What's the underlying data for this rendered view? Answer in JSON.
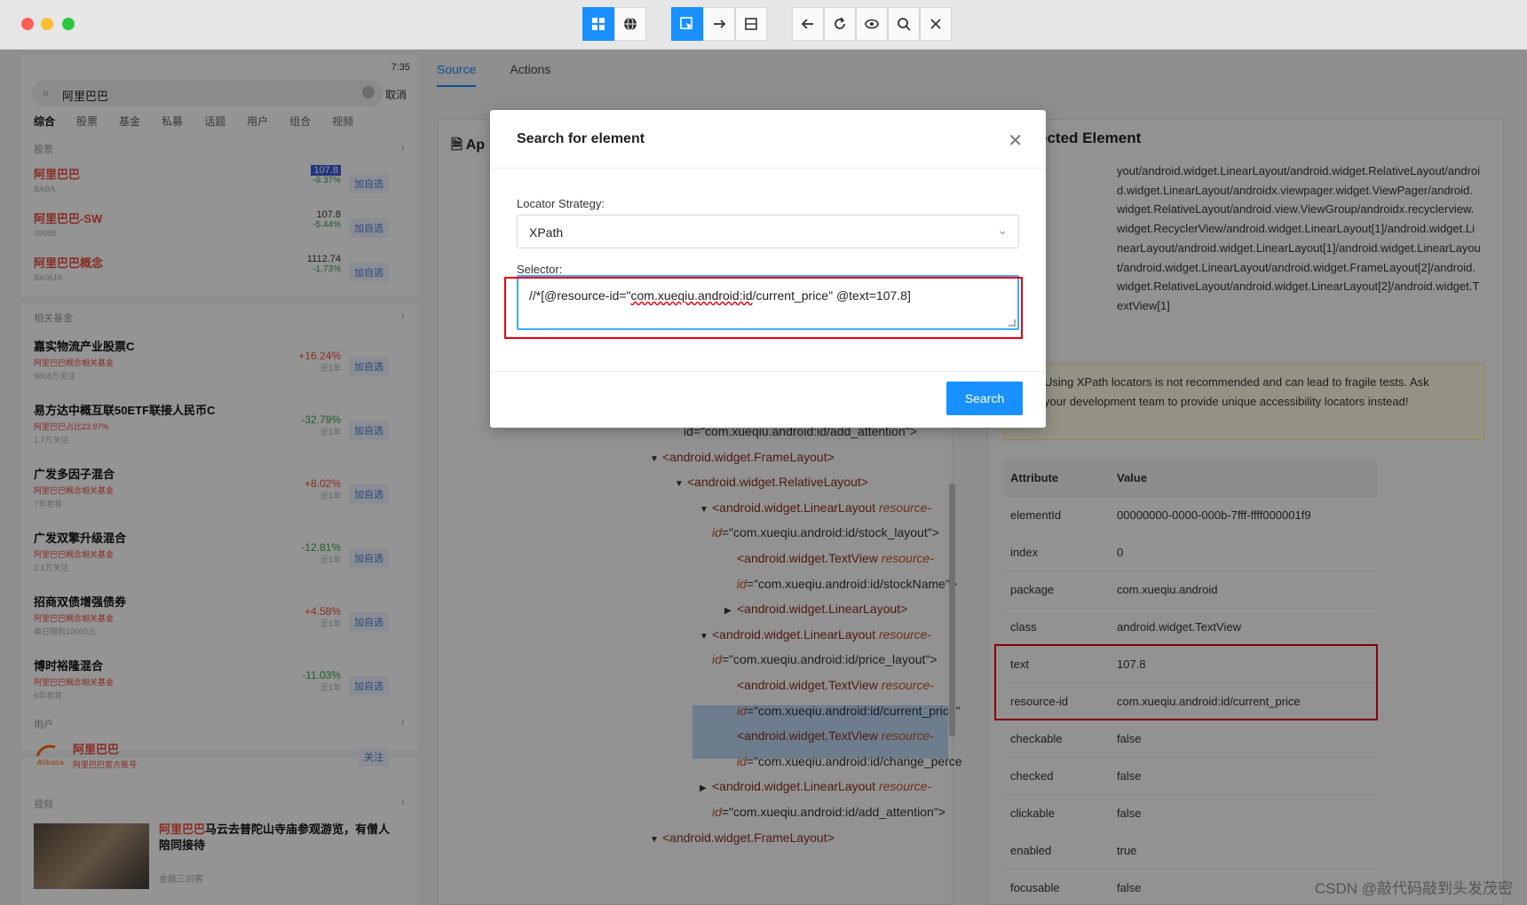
{
  "toolbar": {
    "buttons": [
      "grid-icon",
      "globe-icon",
      "select-element-icon",
      "swipe-icon",
      "tap-coordinates-icon",
      "back-icon",
      "refresh-icon",
      "show-icon",
      "search-icon",
      "close-icon"
    ]
  },
  "phone": {
    "status": "7:35",
    "search_query": "阿里巴巴",
    "cancel": "取消",
    "categories": [
      "综合",
      "股票",
      "基金",
      "私募",
      "话题",
      "用户",
      "组合",
      "视频"
    ],
    "sections": {
      "stocks": "股票",
      "funds": "相关基金",
      "users": "用户",
      "videos": "视频"
    },
    "add_label": "加自选",
    "follow_label": "关注",
    "stocks": [
      {
        "name": "阿里巴巴",
        "code": "BABA",
        "price": "107.8",
        "change": "-9.37%"
      },
      {
        "name": "阿里巴巴-SW",
        "code": "09988",
        "price": "107.8",
        "change": "-5.44%"
      },
      {
        "name": "阿里巴巴概念",
        "code": "BK0519",
        "price": "1112.74",
        "change": "-1.73%"
      }
    ],
    "funds": [
      {
        "name": "嘉实物流产业股票C",
        "tag": "阿里巴巴概念相关基金",
        "sub": "9868万关注",
        "pct": "+16.24%",
        "period": "近1年"
      },
      {
        "name": "易方达中概互联50ETF联接人民币C",
        "tag": "阿里巴巴占比23.97%",
        "sub": "1.7万关注",
        "pct": "-32.79%",
        "period": "近1年"
      },
      {
        "name": "广发多因子混合",
        "tag": "阿里巴巴概念相关基金",
        "sub": "7年老将",
        "pct": "+8.02%",
        "period": "近1年"
      },
      {
        "name": "广发双擎升级混合",
        "tag": "阿里巴巴概念相关基金",
        "sub": "2.1万关注",
        "pct": "-12.81%",
        "period": "近1年"
      },
      {
        "name": "招商双债增强债券",
        "tag": "阿里巴巴概念相关基金",
        "sub": "单日限购10000元",
        "pct": "+4.58%",
        "period": "近1年"
      },
      {
        "name": "博时裕隆混合",
        "tag": "阿里巴巴概念相关基金",
        "sub": "6年老将",
        "pct": "-11.03%",
        "period": "近1年"
      }
    ],
    "user": {
      "name": "阿里巴巴",
      "desc": "阿里巴巴官方账号"
    },
    "video": {
      "highlight": "阿里巴巴",
      "title": "马云去普陀山寺庙参观游览，有僧人陪同接待",
      "source": "金融三剑客"
    }
  },
  "tabs": [
    {
      "label": "Source",
      "active": true
    },
    {
      "label": "Actions",
      "active": false
    }
  ],
  "source_panel": {
    "title": "Ap",
    "tree": [
      {
        "indent": 0,
        "toggle": "",
        "tag": "",
        "attr": "",
        "val": "id=\"com.xueqiu.android:id/add_attention\">"
      },
      {
        "indent": 1,
        "toggle": "▼",
        "tag": "<android.widget.FrameLayout>",
        "attr": "",
        "val": ""
      },
      {
        "indent": 2,
        "toggle": "▼",
        "tag": "<android.widget.RelativeLayout>",
        "attr": "",
        "val": ""
      },
      {
        "indent": 3,
        "toggle": "▼",
        "tag": "<android.widget.LinearLayout",
        "attr": " resource-",
        "val": ""
      },
      {
        "indent": 3,
        "toggle": "",
        "tag": "",
        "attr": "id",
        "val": "=\"com.xueqiu.android:id/stock_layout\">"
      },
      {
        "indent": 4,
        "toggle": "",
        "tag": "<android.widget.TextView",
        "attr": " resource-",
        "val": ""
      },
      {
        "indent": 4,
        "toggle": "",
        "tag": "",
        "attr": "id",
        "val": "=\"com.xueqiu.android:id/stockName\">"
      },
      {
        "indent": 4,
        "toggle": "▶",
        "tag": "<android.widget.LinearLayout>",
        "attr": "",
        "val": ""
      },
      {
        "indent": 3,
        "toggle": "▼",
        "tag": "<android.widget.LinearLayout",
        "attr": " resource-",
        "val": ""
      },
      {
        "indent": 3,
        "toggle": "",
        "tag": "",
        "attr": "id",
        "val": "=\"com.xueqiu.android:id/price_layout\">"
      },
      {
        "indent": 4,
        "toggle": "",
        "tag": "<android.widget.TextView",
        "attr": " resource-",
        "val": ""
      },
      {
        "indent": 4,
        "toggle": "",
        "tag": "",
        "attr": "id",
        "val": "=\"com.xueqiu.android:id/current_price\""
      },
      {
        "indent": 4,
        "toggle": "",
        "tag": "<android.widget.TextView",
        "attr": " resource-",
        "val": ""
      },
      {
        "indent": 4,
        "toggle": "",
        "tag": "",
        "attr": "id",
        "val": "=\"com.xueqiu.android:id/change_perce"
      },
      {
        "indent": 3,
        "toggle": "▶",
        "tag": "<android.widget.LinearLayout",
        "attr": " resource-",
        "val": ""
      },
      {
        "indent": 3,
        "toggle": "",
        "tag": "",
        "attr": "id",
        "val": "=\"com.xueqiu.android:id/add_attention\">"
      },
      {
        "indent": 1,
        "toggle": "▼",
        "tag": "<android.widget.FrameLayout>",
        "attr": "",
        "val": ""
      }
    ]
  },
  "selected_panel": {
    "title": "ected Element",
    "xpath": "yout/android.widget.LinearLayout/android.widget.RelativeLayout/android.widget.LinearLayout/androidx.viewpager.widget.ViewPager/android.widget.RelativeLayout/android.view.ViewGroup/androidx.recyclerview.widget.RecyclerView/android.widget.LinearLayout[1]/android.widget.LinearLayout/android.widget.LinearLayout[1]/android.widget.LinearLayout/android.widget.LinearLayout/android.widget.FrameLayout[2]/android.widget.RelativeLayout/android.widget.LinearLayout[2]/android.widget.TextView[1]",
    "warning": "Using XPath locators is not recommended and can lead to fragile tests. Ask your development team to provide unique accessibility locators instead!",
    "attr_header": {
      "key": "Attribute",
      "value": "Value"
    },
    "attributes": [
      {
        "key": "elementId",
        "value": "00000000-0000-000b-7fff-ffff000001f9"
      },
      {
        "key": "index",
        "value": "0"
      },
      {
        "key": "package",
        "value": "com.xueqiu.android"
      },
      {
        "key": "class",
        "value": "android.widget.TextView"
      },
      {
        "key": "text",
        "value": "107.8"
      },
      {
        "key": "resource-id",
        "value": "com.xueqiu.android:id/current_price"
      },
      {
        "key": "checkable",
        "value": "false"
      },
      {
        "key": "checked",
        "value": "false"
      },
      {
        "key": "clickable",
        "value": "false"
      },
      {
        "key": "enabled",
        "value": "true"
      },
      {
        "key": "focusable",
        "value": "false"
      }
    ]
  },
  "modal": {
    "title": "Search for element",
    "strategy_label": "Locator Strategy:",
    "strategy_value": "XPath",
    "selector_label": "Selector:",
    "selector_prefix": "//*[@resource-id=\"",
    "selector_id": "com.xueqiu.android:id",
    "selector_suffix": "/current_price\" @text=107.8]",
    "search_button": "Search"
  },
  "watermark": "CSDN @敲代码敲到头发茂密",
  "colors": {
    "accent": "#1890ff",
    "highlight": "#e50012",
    "up": "#e94b3c",
    "down": "#2e9e4a"
  }
}
